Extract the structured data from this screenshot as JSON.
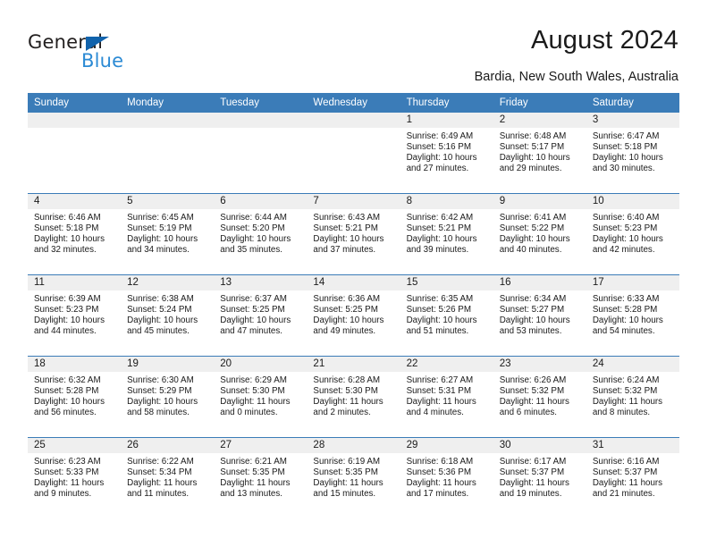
{
  "brand": {
    "name_part1": "General",
    "name_part2": "Blue",
    "logo_icon": "triangle-icon",
    "accent_color": "#2b8ad4",
    "dark_color": "#221f1f"
  },
  "header": {
    "title": "August 2024",
    "subtitle": "Bardia, New South Wales, Australia"
  },
  "calendar": {
    "header_bg": "#3b7cb8",
    "daynum_bg": "#efefef",
    "weekdays": [
      "Sunday",
      "Monday",
      "Tuesday",
      "Wednesday",
      "Thursday",
      "Friday",
      "Saturday"
    ],
    "weeks": [
      [
        {
          "day": "",
          "sunrise": "",
          "sunset": "",
          "daylight": "",
          "daylight2": ""
        },
        {
          "day": "",
          "sunrise": "",
          "sunset": "",
          "daylight": "",
          "daylight2": ""
        },
        {
          "day": "",
          "sunrise": "",
          "sunset": "",
          "daylight": "",
          "daylight2": ""
        },
        {
          "day": "",
          "sunrise": "",
          "sunset": "",
          "daylight": "",
          "daylight2": ""
        },
        {
          "day": "1",
          "sunrise": "Sunrise: 6:49 AM",
          "sunset": "Sunset: 5:16 PM",
          "daylight": "Daylight: 10 hours",
          "daylight2": "and 27 minutes."
        },
        {
          "day": "2",
          "sunrise": "Sunrise: 6:48 AM",
          "sunset": "Sunset: 5:17 PM",
          "daylight": "Daylight: 10 hours",
          "daylight2": "and 29 minutes."
        },
        {
          "day": "3",
          "sunrise": "Sunrise: 6:47 AM",
          "sunset": "Sunset: 5:18 PM",
          "daylight": "Daylight: 10 hours",
          "daylight2": "and 30 minutes."
        }
      ],
      [
        {
          "day": "4",
          "sunrise": "Sunrise: 6:46 AM",
          "sunset": "Sunset: 5:18 PM",
          "daylight": "Daylight: 10 hours",
          "daylight2": "and 32 minutes."
        },
        {
          "day": "5",
          "sunrise": "Sunrise: 6:45 AM",
          "sunset": "Sunset: 5:19 PM",
          "daylight": "Daylight: 10 hours",
          "daylight2": "and 34 minutes."
        },
        {
          "day": "6",
          "sunrise": "Sunrise: 6:44 AM",
          "sunset": "Sunset: 5:20 PM",
          "daylight": "Daylight: 10 hours",
          "daylight2": "and 35 minutes."
        },
        {
          "day": "7",
          "sunrise": "Sunrise: 6:43 AM",
          "sunset": "Sunset: 5:21 PM",
          "daylight": "Daylight: 10 hours",
          "daylight2": "and 37 minutes."
        },
        {
          "day": "8",
          "sunrise": "Sunrise: 6:42 AM",
          "sunset": "Sunset: 5:21 PM",
          "daylight": "Daylight: 10 hours",
          "daylight2": "and 39 minutes."
        },
        {
          "day": "9",
          "sunrise": "Sunrise: 6:41 AM",
          "sunset": "Sunset: 5:22 PM",
          "daylight": "Daylight: 10 hours",
          "daylight2": "and 40 minutes."
        },
        {
          "day": "10",
          "sunrise": "Sunrise: 6:40 AM",
          "sunset": "Sunset: 5:23 PM",
          "daylight": "Daylight: 10 hours",
          "daylight2": "and 42 minutes."
        }
      ],
      [
        {
          "day": "11",
          "sunrise": "Sunrise: 6:39 AM",
          "sunset": "Sunset: 5:23 PM",
          "daylight": "Daylight: 10 hours",
          "daylight2": "and 44 minutes."
        },
        {
          "day": "12",
          "sunrise": "Sunrise: 6:38 AM",
          "sunset": "Sunset: 5:24 PM",
          "daylight": "Daylight: 10 hours",
          "daylight2": "and 45 minutes."
        },
        {
          "day": "13",
          "sunrise": "Sunrise: 6:37 AM",
          "sunset": "Sunset: 5:25 PM",
          "daylight": "Daylight: 10 hours",
          "daylight2": "and 47 minutes."
        },
        {
          "day": "14",
          "sunrise": "Sunrise: 6:36 AM",
          "sunset": "Sunset: 5:25 PM",
          "daylight": "Daylight: 10 hours",
          "daylight2": "and 49 minutes."
        },
        {
          "day": "15",
          "sunrise": "Sunrise: 6:35 AM",
          "sunset": "Sunset: 5:26 PM",
          "daylight": "Daylight: 10 hours",
          "daylight2": "and 51 minutes."
        },
        {
          "day": "16",
          "sunrise": "Sunrise: 6:34 AM",
          "sunset": "Sunset: 5:27 PM",
          "daylight": "Daylight: 10 hours",
          "daylight2": "and 53 minutes."
        },
        {
          "day": "17",
          "sunrise": "Sunrise: 6:33 AM",
          "sunset": "Sunset: 5:28 PM",
          "daylight": "Daylight: 10 hours",
          "daylight2": "and 54 minutes."
        }
      ],
      [
        {
          "day": "18",
          "sunrise": "Sunrise: 6:32 AM",
          "sunset": "Sunset: 5:28 PM",
          "daylight": "Daylight: 10 hours",
          "daylight2": "and 56 minutes."
        },
        {
          "day": "19",
          "sunrise": "Sunrise: 6:30 AM",
          "sunset": "Sunset: 5:29 PM",
          "daylight": "Daylight: 10 hours",
          "daylight2": "and 58 minutes."
        },
        {
          "day": "20",
          "sunrise": "Sunrise: 6:29 AM",
          "sunset": "Sunset: 5:30 PM",
          "daylight": "Daylight: 11 hours",
          "daylight2": "and 0 minutes."
        },
        {
          "day": "21",
          "sunrise": "Sunrise: 6:28 AM",
          "sunset": "Sunset: 5:30 PM",
          "daylight": "Daylight: 11 hours",
          "daylight2": "and 2 minutes."
        },
        {
          "day": "22",
          "sunrise": "Sunrise: 6:27 AM",
          "sunset": "Sunset: 5:31 PM",
          "daylight": "Daylight: 11 hours",
          "daylight2": "and 4 minutes."
        },
        {
          "day": "23",
          "sunrise": "Sunrise: 6:26 AM",
          "sunset": "Sunset: 5:32 PM",
          "daylight": "Daylight: 11 hours",
          "daylight2": "and 6 minutes."
        },
        {
          "day": "24",
          "sunrise": "Sunrise: 6:24 AM",
          "sunset": "Sunset: 5:32 PM",
          "daylight": "Daylight: 11 hours",
          "daylight2": "and 8 minutes."
        }
      ],
      [
        {
          "day": "25",
          "sunrise": "Sunrise: 6:23 AM",
          "sunset": "Sunset: 5:33 PM",
          "daylight": "Daylight: 11 hours",
          "daylight2": "and 9 minutes."
        },
        {
          "day": "26",
          "sunrise": "Sunrise: 6:22 AM",
          "sunset": "Sunset: 5:34 PM",
          "daylight": "Daylight: 11 hours",
          "daylight2": "and 11 minutes."
        },
        {
          "day": "27",
          "sunrise": "Sunrise: 6:21 AM",
          "sunset": "Sunset: 5:35 PM",
          "daylight": "Daylight: 11 hours",
          "daylight2": "and 13 minutes."
        },
        {
          "day": "28",
          "sunrise": "Sunrise: 6:19 AM",
          "sunset": "Sunset: 5:35 PM",
          "daylight": "Daylight: 11 hours",
          "daylight2": "and 15 minutes."
        },
        {
          "day": "29",
          "sunrise": "Sunrise: 6:18 AM",
          "sunset": "Sunset: 5:36 PM",
          "daylight": "Daylight: 11 hours",
          "daylight2": "and 17 minutes."
        },
        {
          "day": "30",
          "sunrise": "Sunrise: 6:17 AM",
          "sunset": "Sunset: 5:37 PM",
          "daylight": "Daylight: 11 hours",
          "daylight2": "and 19 minutes."
        },
        {
          "day": "31",
          "sunrise": "Sunrise: 6:16 AM",
          "sunset": "Sunset: 5:37 PM",
          "daylight": "Daylight: 11 hours",
          "daylight2": "and 21 minutes."
        }
      ]
    ]
  }
}
